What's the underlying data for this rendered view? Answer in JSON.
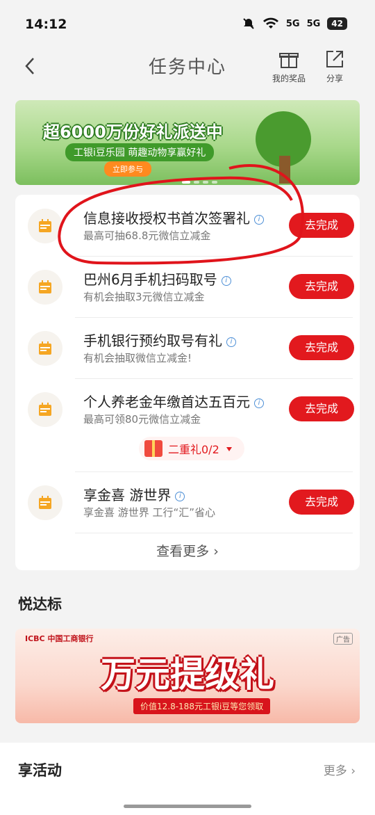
{
  "status_bar": {
    "time": "14:12",
    "signal_1": "5G",
    "signal_2": "5G",
    "battery": "42"
  },
  "header": {
    "title": "任务中心",
    "prizes_label": "我的奖品",
    "share_label": "分享"
  },
  "banner": {
    "headline": "超6000万份好礼派送中",
    "subline": "工银i豆乐园 萌趣动物享赢好礼",
    "join_label": "立即参与"
  },
  "tasks": [
    {
      "name": "信息接收授权书首次签署礼",
      "desc": "最高可抽68.8元微信立减金",
      "action": "去完成"
    },
    {
      "name": "巴州6月手机扫码取号",
      "desc": "有机会抽取3元微信立减金",
      "action": "去完成"
    },
    {
      "name": "手机银行预约取号有礼",
      "desc": "有机会抽取微信立减金!",
      "action": "去完成"
    },
    {
      "name": "个人养老金年缴首达五百元",
      "desc": "最高可领80元微信立减金",
      "action": "去完成",
      "gift": "二重礼0/2"
    },
    {
      "name": "享金喜 游世界",
      "desc": "享金喜 游世界 工行“汇”省心",
      "action": "去完成"
    }
  ],
  "see_more": "查看更多",
  "section1": {
    "title": "悦达标"
  },
  "ad": {
    "brand": "ICBC  中国工商银行",
    "tag": "广告",
    "headline": "万元提级礼",
    "subline": "价值12.8-188元工银i豆等您领取"
  },
  "section2": {
    "title": "享活动",
    "more": "更多"
  },
  "colors": {
    "accent": "#e2191e",
    "task_icon": "#f5a623"
  }
}
